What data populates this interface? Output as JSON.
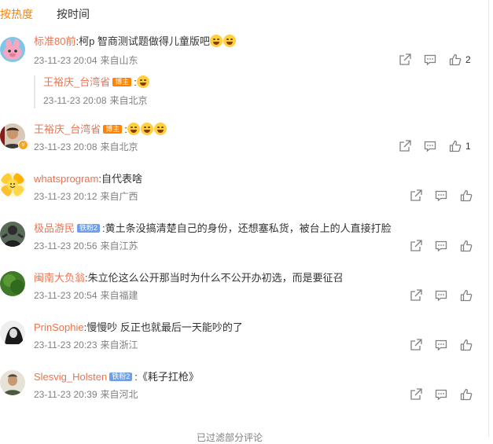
{
  "sort": {
    "hot": "按热度",
    "time": "按时间"
  },
  "comments": [
    {
      "user": "标准80前",
      "text": "柯p 智商测试题做得儿童版吧",
      "emoji_count": 2,
      "time": "23-11-23 20:04",
      "location": "来自山东",
      "likes": "2",
      "avatar_icon": "pink-cartoon-avatar",
      "reply": {
        "user": "王裕庆_台湾省",
        "badge": "博主",
        "time": "23-11-23 20:08",
        "location": "来自北京"
      }
    },
    {
      "user": "王裕庆_台湾省",
      "badge": "博主",
      "emoji_count": 3,
      "time": "23-11-23 20:08",
      "location": "来自北京",
      "likes": "1",
      "avatar_icon": "person-avatar-verified"
    },
    {
      "user": "whatsprogram",
      "text": "自代表啥",
      "time": "23-11-23 20:12",
      "location": "来自广西",
      "likes": "",
      "avatar_icon": "emoji-collage-avatar"
    },
    {
      "user": "极品游民",
      "badge": "铁粉2",
      "text": "黄土条没搞清楚自己的身份，还想塞私货，被台上的人直接打脸",
      "time": "23-11-23 20:56",
      "location": "来自江苏",
      "likes": "",
      "avatar_icon": "dark-figure-avatar"
    },
    {
      "user": "闽南大负翁",
      "text": "朱立伦这么公开那当时为什么不公开办初选，而是要征召",
      "time": "23-11-23 20:54",
      "location": "来自福建",
      "likes": "",
      "avatar_icon": "green-circle-avatar"
    },
    {
      "user": "PrinSophie",
      "text": "慢慢吵 反正也就最后一天能吵的了",
      "time": "23-11-23 20:23",
      "location": "来自浙江",
      "likes": "",
      "avatar_icon": "bw-portrait-avatar"
    },
    {
      "user": "Slesvig_Holsten",
      "badge": "铁粉2",
      "text": "《耗子扛枪》",
      "time": "23-11-23 20:39",
      "location": "来自河北",
      "likes": "",
      "avatar_icon": "man-portrait-avatar"
    }
  ],
  "more_text": "已过滤部分评论",
  "colors": {
    "accent": "#ff8200",
    "username": "#eb7350",
    "meta": "#808080",
    "fan_badge": "#6e9fe8"
  }
}
